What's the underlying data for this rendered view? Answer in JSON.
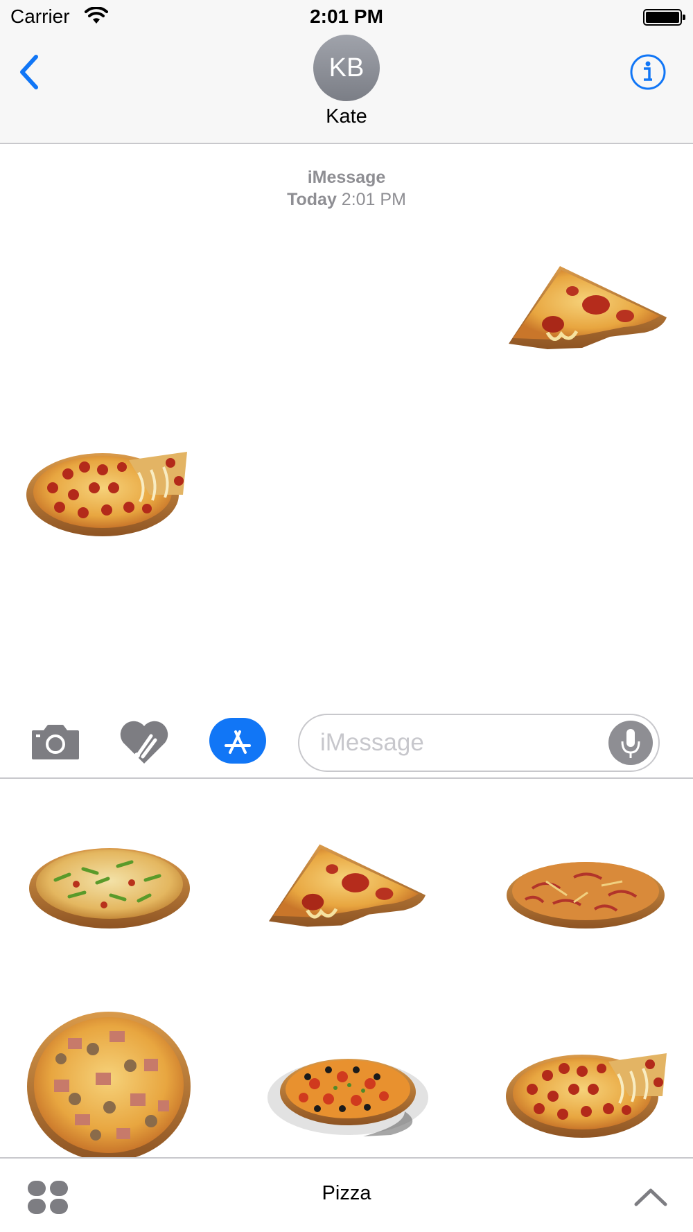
{
  "status_bar": {
    "carrier": "Carrier",
    "time": "2:01 PM"
  },
  "header": {
    "avatar_initials": "KB",
    "contact_name": "Kate"
  },
  "conversation": {
    "service": "iMessage",
    "day": "Today",
    "time": "2:01 PM",
    "messages": [
      {
        "type": "sticker",
        "sender": "me",
        "icon": "pizza-slice-pepperoni"
      },
      {
        "type": "sticker",
        "sender": "contact",
        "icon": "pizza-pepperoni-whole"
      }
    ]
  },
  "compose": {
    "placeholder": "iMessage",
    "icons": [
      "camera-icon",
      "digital-touch-icon",
      "app-store-icon",
      "microphone-icon"
    ]
  },
  "sticker_drawer": {
    "title": "Pizza",
    "stickers": [
      "pizza-vegetable",
      "pizza-slice-pepperoni",
      "pizza-onion",
      "pizza-ham-mushroom",
      "pizza-olive-tomato-plate",
      "pizza-pepperoni-bitten"
    ]
  },
  "colors": {
    "accent": "#1176f6",
    "bar_background": "#f7f7f7",
    "secondary_text": "#8e8e93"
  }
}
